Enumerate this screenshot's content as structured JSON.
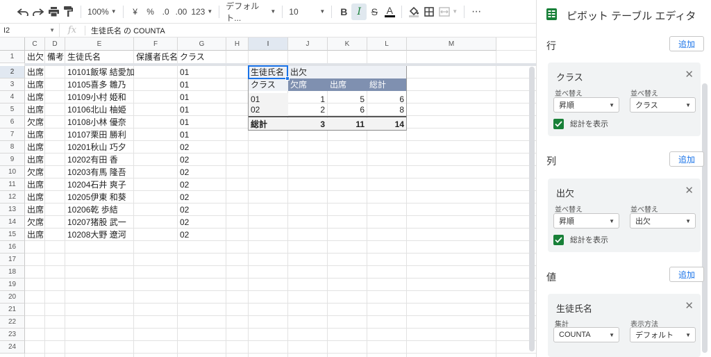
{
  "toolbar": {
    "zoom": "100%",
    "currency": "¥",
    "percent": "%",
    "dec_decrease": ".0",
    "dec_increase": ".00",
    "number_format": "123",
    "font": "デフォルト...",
    "font_size": "10",
    "bold": "B",
    "italic": "I",
    "strike": "S",
    "text_color": "A",
    "more": "⋯"
  },
  "formula_bar": {
    "cell_ref": "I2",
    "fx": "fx",
    "formula": "生徒氏名 の  COUNTA"
  },
  "sheet": {
    "columns": [
      "C",
      "D",
      "E",
      "F",
      "G",
      "H",
      "I",
      "J",
      "K",
      "L",
      "M"
    ],
    "rows": [
      "1",
      "2",
      "3",
      "4",
      "5",
      "6",
      "7",
      "8",
      "9",
      "10",
      "11",
      "12",
      "13",
      "14",
      "15",
      "16",
      "17",
      "18",
      "19",
      "20",
      "21",
      "22",
      "23",
      "24"
    ],
    "header_row": [
      "出欠",
      "備考",
      "生徒氏名",
      "保護者氏名",
      "クラス"
    ],
    "data": [
      [
        "出席",
        "",
        "10101飯塚 結愛加",
        "",
        "01"
      ],
      [
        "出席",
        "",
        "10105喜多 雛乃",
        "",
        "01"
      ],
      [
        "出席",
        "",
        "10109小村 姫和",
        "",
        "01"
      ],
      [
        "出席",
        "",
        "10106北山 柚姫",
        "",
        "01"
      ],
      [
        "欠席",
        "",
        "10108小林 優奈",
        "",
        "01"
      ],
      [
        "出席",
        "",
        "10107栗田 勝利",
        "",
        "01"
      ],
      [
        "出席",
        "",
        "10201秋山 巧夕",
        "",
        "02"
      ],
      [
        "出席",
        "",
        "10202有田 香",
        "",
        "02"
      ],
      [
        "欠席",
        "",
        "10203有馬 隆吾",
        "",
        "02"
      ],
      [
        "出席",
        "",
        "10204石井 爽子",
        "",
        "02"
      ],
      [
        "出席",
        "",
        "10205伊東 和葵",
        "",
        "02"
      ],
      [
        "出席",
        "",
        "10206乾 歩結",
        "",
        "02"
      ],
      [
        "欠席",
        "",
        "10207猪股 武一",
        "",
        "02"
      ],
      [
        "出席",
        "",
        "10208大野 遼河",
        "",
        "02"
      ]
    ]
  },
  "pivot": {
    "value_label": "生徒氏名 の",
    "col_field": "出欠",
    "row_field": "クラス",
    "col_headers": [
      "欠席",
      "出席",
      "総計"
    ],
    "rows": [
      {
        "label": "01",
        "values": [
          "1",
          "5",
          "6"
        ]
      },
      {
        "label": "02",
        "values": [
          "2",
          "6",
          "8"
        ]
      }
    ],
    "total": {
      "label": "総計",
      "values": [
        "3",
        "11",
        "14"
      ]
    }
  },
  "panel": {
    "title": "ピボット テーブル エディタ",
    "rows_label": "行",
    "cols_label": "列",
    "values_label": "値",
    "add_label": "追加",
    "row_card": {
      "title": "クラス",
      "sort_label": "並べ替え",
      "sort_value": "昇順",
      "sortby_label": "並べ替え",
      "sortby_value": "クラス",
      "show_totals": "総計を表示"
    },
    "col_card": {
      "title": "出欠",
      "sort_label": "並べ替え",
      "sort_value": "昇順",
      "sortby_label": "並べ替え",
      "sortby_value": "出欠",
      "show_totals": "総計を表示"
    },
    "value_card": {
      "title": "生徒氏名",
      "summarize_label": "集計",
      "summarize_value": "COUNTA",
      "display_label": "表示方法",
      "display_value": "デフォルト"
    }
  },
  "colors": {
    "pivot_header": "#7f90b0",
    "selection": "#1a73e8",
    "checkbox": "#188038"
  }
}
